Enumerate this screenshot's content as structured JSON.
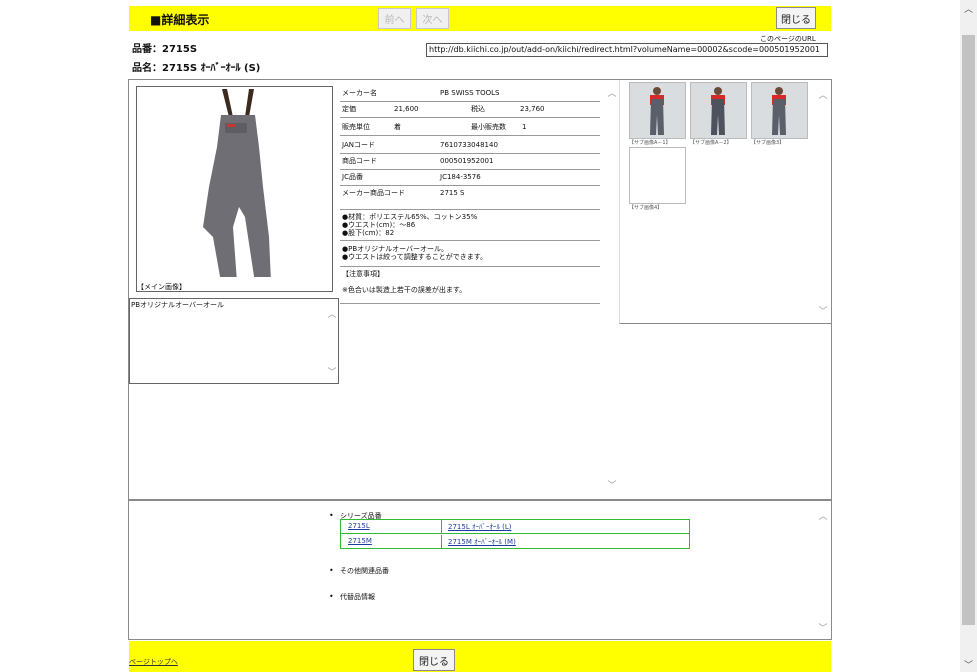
{
  "header": {
    "title": "■詳細表示",
    "prev_label": "前へ",
    "next_label": "次へ",
    "close_label": "閉じる"
  },
  "product": {
    "number_label": "品番：2715S",
    "name_label": "品名：2715S ｵｰﾊﾞｰｵｰﾙ (S)"
  },
  "url": {
    "caption": "このページのURL",
    "value": "http://db.kiichi.co.jp/out/add-on/kiichi/redirect.html?volumeName=00002&scode=000501952001"
  },
  "main_image": {
    "caption": "【メイン画像】"
  },
  "description": {
    "text": "PBオリジナルオーバーオール"
  },
  "spec": {
    "maker_label": "メーカー名",
    "maker_value": "PB SWISS TOOLS",
    "list_price_label": "定価",
    "list_price_value": "21,600",
    "tax_in_label": "税込",
    "tax_in_value": "23,760",
    "sales_unit_label": "販売単位",
    "sales_unit_value": "着",
    "min_qty_label": "最小販売数",
    "min_qty_value": "1",
    "jan_label": "JANコード",
    "jan_value": "7610733048140",
    "product_code_label": "商品コード",
    "product_code_value": "000501952001",
    "jc_label": "JC品番",
    "jc_value": "JC184-3576",
    "maker_code_label": "メーカー商品コード",
    "maker_code_value": "2715 S",
    "features": [
      "●材質：ポリエステル65%、コットン35%",
      "●ウエスト(cm)：～86",
      "●股下(cm)：82"
    ],
    "notes": [
      "●PBオリジナルオーバーオール。",
      "●ウエストは絞って調整することができます。"
    ],
    "caution_title": "【注意事項】",
    "caution_text": "※色合いは製造上若干の誤差が出ます。"
  },
  "sub_images": {
    "captions": [
      "【サブ画像A－1】",
      "【サブ画像A－2】",
      "【サブ画像3】",
      "【サブ画像4】"
    ]
  },
  "related": {
    "series_title": "シリーズ品番",
    "rows": [
      {
        "code": "2715L",
        "name": "2715L ｵｰﾊﾞｰｵｰﾙ (L)"
      },
      {
        "code": "2715M",
        "name": "2715M ｵｰﾊﾞｰｵｰﾙ (M)"
      }
    ],
    "other_title": "その他関連品番",
    "substitute_title": "代替品情報"
  },
  "footer": {
    "page_top_label": "ページトップへ",
    "close_label": "閉じる"
  },
  "colors": {
    "bar": "#ffff00",
    "table_border": "#33bb33"
  }
}
